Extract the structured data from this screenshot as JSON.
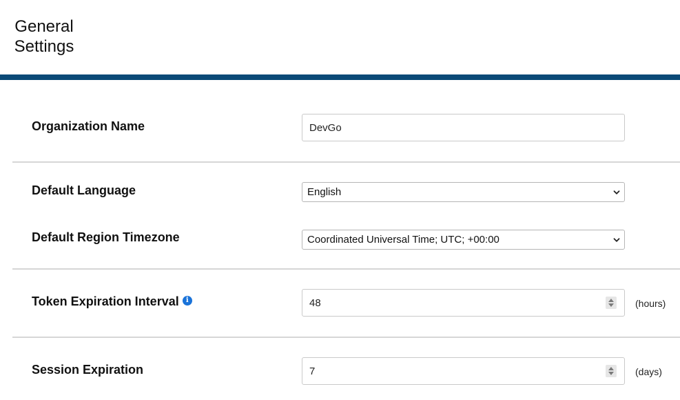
{
  "header": {
    "title_line1": "General",
    "title_line2": "Settings"
  },
  "colors": {
    "header_bar": "#0b4a77",
    "info_icon": "#1a73d9"
  },
  "organization_name": {
    "label": "Organization Name",
    "value": "DevGo"
  },
  "default_language": {
    "label": "Default Language",
    "selected": "English",
    "icon": "chevron-down-icon"
  },
  "default_region_timezone": {
    "label": "Default Region Timezone",
    "selected": "Coordinated Universal Time; UTC; +00:00",
    "icon": "chevron-down-icon"
  },
  "token_expiration_interval": {
    "label": "Token Expiration Interval",
    "info_icon": "info-icon",
    "value": "48",
    "unit": "(hours)"
  },
  "session_expiration": {
    "label": "Session Expiration",
    "value": "7",
    "unit": "(days)"
  }
}
